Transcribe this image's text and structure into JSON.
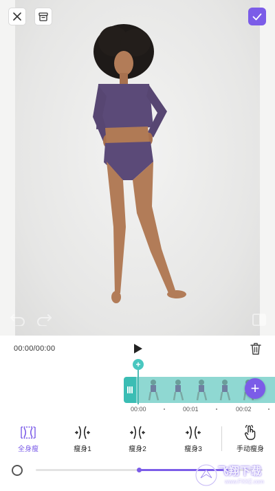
{
  "player": {
    "time": "00:00/00:00"
  },
  "timeline": {
    "ticks": [
      "00:00",
      "00:01",
      "00:02"
    ]
  },
  "tools": [
    {
      "label": "全身瘦",
      "active": true
    },
    {
      "label": "瘦身1",
      "active": false
    },
    {
      "label": "瘦身2",
      "active": false
    },
    {
      "label": "瘦身3",
      "active": false
    },
    {
      "label": "手动瘦身",
      "active": false
    }
  ],
  "slider": {
    "level": 0.4
  },
  "watermark": {
    "text": "飞翔下载",
    "url": "www.FXXZ.com"
  },
  "icons": {
    "close": "close-icon",
    "save_draft": "archive-icon",
    "confirm": "check-icon",
    "undo": "undo-icon",
    "redo": "redo-icon",
    "compare": "compare-icon",
    "play": "play-icon",
    "delete": "trash-icon",
    "add_clip": "plus-icon"
  },
  "colors": {
    "accent": "#7b5ce8",
    "timeline": "#8fd8d2",
    "timeline_handle": "#3bbdb4"
  }
}
